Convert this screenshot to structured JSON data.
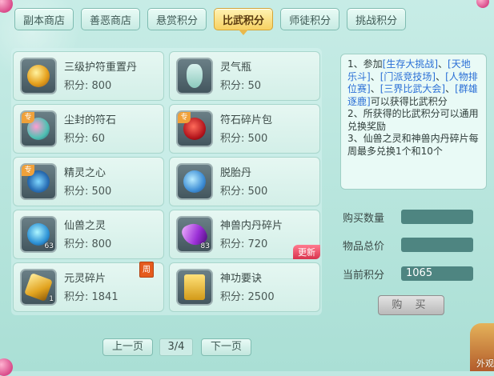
{
  "tabs": [
    {
      "label": "副本商店"
    },
    {
      "label": "善恶商店"
    },
    {
      "label": "悬赏积分"
    },
    {
      "label": "比武积分"
    },
    {
      "label": "师徒积分"
    },
    {
      "label": "挑战积分"
    }
  ],
  "active_tab": "比武积分",
  "items": [
    {
      "name": "三级护符重置丹",
      "price": "积分: 800",
      "icon": "golden-amulet-pill-icon"
    },
    {
      "name": "灵气瓶",
      "price": "积分: 50",
      "icon": "spirit-bottle-icon"
    },
    {
      "name": "尘封的符石",
      "price": "积分: 60",
      "icon": "sealed-rune-stone-icon",
      "badge": "专"
    },
    {
      "name": "符石碎片包",
      "price": "积分: 500",
      "icon": "rune-fragment-bag-icon",
      "badge": "专"
    },
    {
      "name": "精灵之心",
      "price": "积分: 500",
      "icon": "elf-heart-icon",
      "badge": "专"
    },
    {
      "name": "脱胎丹",
      "price": "积分: 500",
      "icon": "rebirth-pill-icon"
    },
    {
      "name": "仙兽之灵",
      "price": "积分: 800",
      "icon": "immortal-beast-spirit-icon",
      "count": "63"
    },
    {
      "name": "神兽内丹碎片",
      "price": "积分: 720",
      "icon": "divine-beast-core-fragment-icon",
      "count": "83",
      "tag": "更新"
    },
    {
      "name": "元灵碎片",
      "price": "积分: 1841",
      "icon": "yuanling-fragment-icon",
      "count": "1",
      "tag": "周"
    },
    {
      "name": "神功要诀",
      "price": "积分: 2500",
      "icon": "martial-manual-icon"
    }
  ],
  "info": {
    "line1_prefix": "1、参加",
    "link1": "[生存大挑战]",
    "sep1": "、",
    "link2": "[天地乐斗]",
    "sep2": "、",
    "link3": "[门派竞技场]",
    "sep3": "、",
    "link4": "[人物排位赛]",
    "sep4": "、",
    "link5": "[三界比武大会]",
    "sep5": "、",
    "link6": "[群雄逐鹿]",
    "line1_suffix": "可以获得比武积分",
    "line2": "2、所获得的比武积分可以通用兑换奖励",
    "line3": "3、仙兽之灵和神兽内丹碎片每周最多兑换1个和10个"
  },
  "form": {
    "qty_label": "购买数量",
    "qty_value": "",
    "total_label": "物品总价",
    "total_value": "",
    "points_label": "当前积分",
    "points_value": "1065"
  },
  "buy_label": "购 买",
  "pager": {
    "prev": "上一页",
    "page": "3/4",
    "next": "下一页"
  },
  "corner_text": "外观",
  "colors": {
    "accent_tab": "#f7d162",
    "link": "#2a6fd6",
    "field": "#4e8581"
  }
}
